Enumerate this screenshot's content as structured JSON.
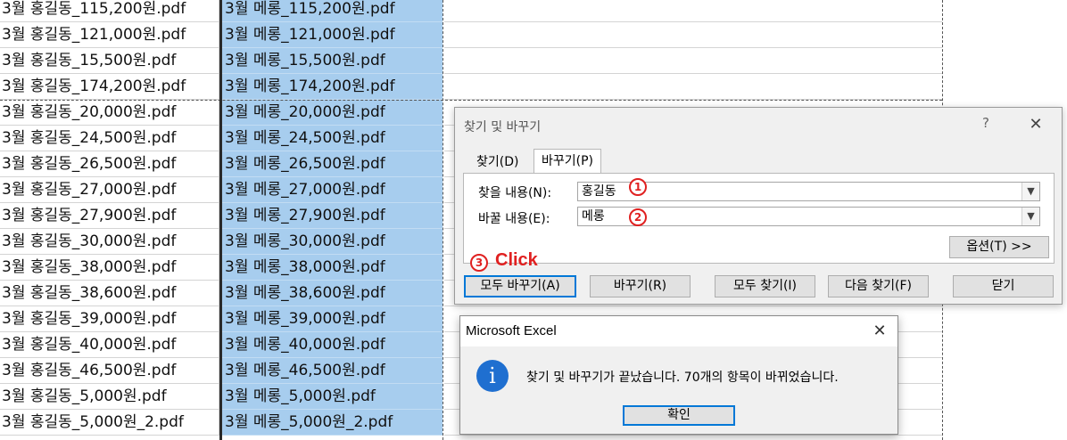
{
  "sheet": {
    "rows": [
      {
        "a": "3월 홍길동_115,200원.pdf",
        "b": "3월 메롱_115,200원.pdf"
      },
      {
        "a": "3월 홍길동_121,000원.pdf",
        "b": "3월 메롱_121,000원.pdf"
      },
      {
        "a": "3월 홍길동_15,500원.pdf",
        "b": "3월 메롱_15,500원.pdf"
      },
      {
        "a": "3월 홍길동_174,200원.pdf",
        "b": "3월 메롱_174,200원.pdf"
      },
      {
        "a": "3월 홍길동_20,000원.pdf",
        "b": "3월 메롱_20,000원.pdf"
      },
      {
        "a": "3월 홍길동_24,500원.pdf",
        "b": "3월 메롱_24,500원.pdf"
      },
      {
        "a": "3월 홍길동_26,500원.pdf",
        "b": "3월 메롱_26,500원.pdf"
      },
      {
        "a": "3월 홍길동_27,000원.pdf",
        "b": "3월 메롱_27,000원.pdf"
      },
      {
        "a": "3월 홍길동_27,900원.pdf",
        "b": "3월 메롱_27,900원.pdf"
      },
      {
        "a": "3월 홍길동_30,000원.pdf",
        "b": "3월 메롱_30,000원.pdf"
      },
      {
        "a": "3월 홍길동_38,000원.pdf",
        "b": "3월 메롱_38,000원.pdf"
      },
      {
        "a": "3월 홍길동_38,600원.pdf",
        "b": "3월 메롱_38,600원.pdf"
      },
      {
        "a": "3월 홍길동_39,000원.pdf",
        "b": "3월 메롱_39,000원.pdf"
      },
      {
        "a": "3월 홍길동_40,000원.pdf",
        "b": "3월 메롱_40,000원.pdf"
      },
      {
        "a": "3월 홍길동_46,500원.pdf",
        "b": "3월 메롱_46,500원.pdf"
      },
      {
        "a": "3월 홍길동_5,000원.pdf",
        "b": "3월 메롱_5,000원.pdf"
      },
      {
        "a": "3월 홍길동_5,000원_2.pdf",
        "b": "3월 메롱_5,000원_2.pdf"
      }
    ]
  },
  "find_replace": {
    "title": "찾기 및 바꾸기",
    "help_label": "?",
    "close_label": "✕",
    "tabs": {
      "find": "찾기(D)",
      "replace": "바꾸기(P)"
    },
    "find_label": "찾을 내용(N):",
    "find_value": "홍길동",
    "replace_label": "바꿀 내용(E):",
    "replace_value": "메롱",
    "options_button": "옵션(T) >>",
    "buttons": {
      "replace_all": "모두 바꾸기(A)",
      "replace": "바꾸기(R)",
      "find_all": "모두 찾기(I)",
      "find_next": "다음 찾기(F)",
      "close": "닫기"
    },
    "annotations": {
      "step1": "1",
      "step2": "2",
      "step3": "3",
      "click": "Click"
    }
  },
  "message_box": {
    "title": "Microsoft Excel",
    "close_label": "✕",
    "icon": "i",
    "text": "찾기 및 바꾸기가 끝났습니다. 70개의 항목이 바뀌었습니다.",
    "ok_button": "확인"
  },
  "colors": {
    "selection": "#a7cdee",
    "annotation": "#e02020",
    "accent": "#0078d7"
  }
}
